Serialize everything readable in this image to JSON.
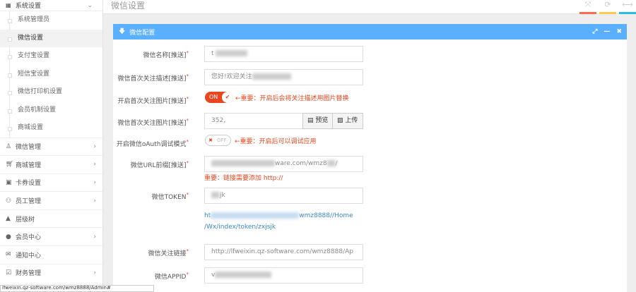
{
  "sidebar": {
    "section": {
      "label": "系统设置",
      "icon": "grid-icon"
    },
    "sub_items": [
      {
        "label": "系统管理员"
      },
      {
        "label": "微信设置",
        "active": true
      },
      {
        "label": "支付宝设置"
      },
      {
        "label": "短信宝设置"
      },
      {
        "label": "微信打印机设置"
      },
      {
        "label": "会员机制设置"
      },
      {
        "label": "商城设置"
      }
    ],
    "items": [
      {
        "label": "微信管理",
        "icon": "penguin-icon",
        "chev": "›"
      },
      {
        "label": "商城管理",
        "icon": "cart-icon",
        "chev": "›"
      },
      {
        "label": "卡券设置",
        "icon": "money-icon",
        "chev": "›"
      },
      {
        "label": "员工管理",
        "icon": "sitemap-icon",
        "chev": "›"
      },
      {
        "label": "层级树",
        "icon": "tree-icon",
        "chev": ""
      },
      {
        "label": "会员中心",
        "icon": "user-icon",
        "chev": "›"
      },
      {
        "label": "通知中心",
        "icon": "envelope-icon",
        "chev": ""
      },
      {
        "label": "财务管理",
        "icon": "checkbox-icon",
        "chev": "›"
      }
    ]
  },
  "header": {
    "title": "微信设置",
    "colors": [
      "#ff6b4f",
      "#ffc94a",
      "#29bde8"
    ]
  },
  "panel": {
    "title": "微信配置",
    "color": "#5aafff"
  },
  "form": {
    "name_label": "微信名称[推送]",
    "name_value": "t",
    "desc_label": "微信首次关注描述[推送]",
    "desc_value": "您好!欢迎关注",
    "img_toggle_label": "开启首次关注图片[推送]",
    "img_toggle_state": "ON",
    "img_toggle_note": "←重要：开启后会将关注描述用图片替换",
    "img_label": "微信首次关注图片[推送]",
    "img_value": "352,",
    "preview_btn": "预览",
    "upload_btn": "上传",
    "oauth_label": "开启微信oAuth调试模式",
    "oauth_state": "OFF",
    "oauth_note": "←重要：开启后可以调试应用",
    "url_label": "微信URL前缀[推送]",
    "url_value": "ware.com/wmz8",
    "url_note": "重要：链接需要添加 http://",
    "token_label": "微信TOKEN",
    "token_value": "jk",
    "token_link_1": "ht",
    "token_link_2": "wmz8888//Home",
    "token_link_3": "/Wx/index/token/zxjsjk",
    "follow_label": "微信关注链接",
    "follow_value": "http://lfweixin.qz-software.com/wmz8888/Ap",
    "appid_label": "微信APPID",
    "appid_value": "v"
  },
  "status_bar": "lfweixin.qz-software.com/wmz8888/Admin#"
}
